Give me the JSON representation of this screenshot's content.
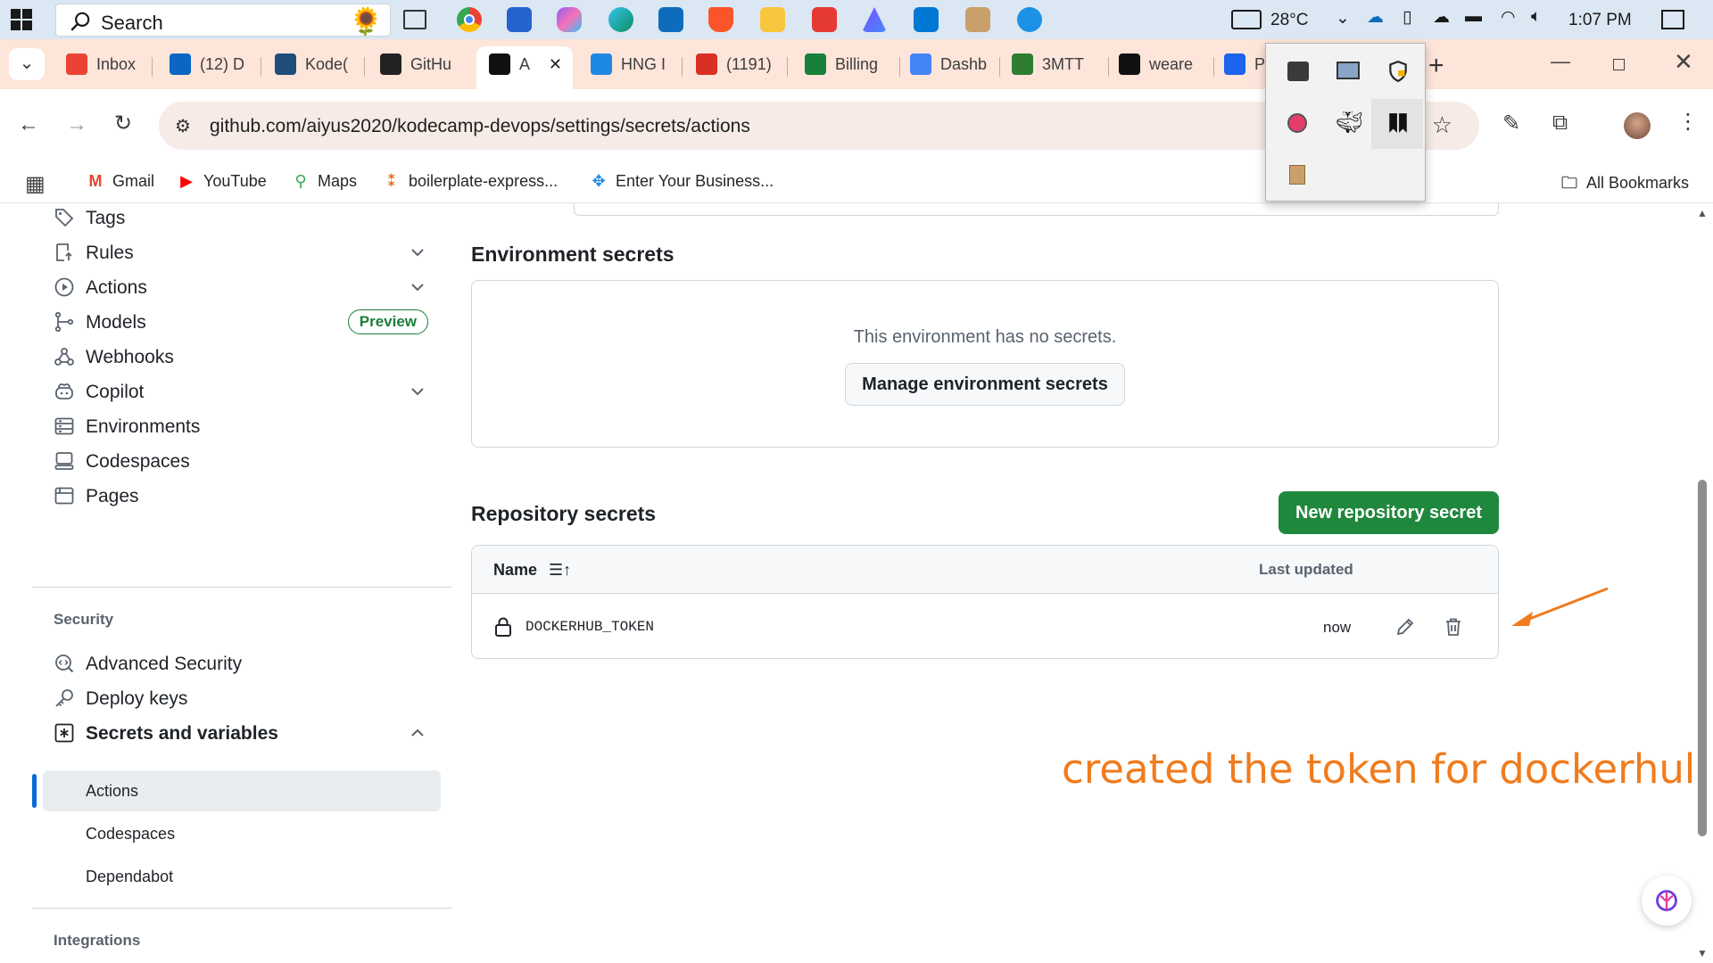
{
  "taskbar": {
    "search_label": "Search",
    "weather": "28°C",
    "time": "1:07 PM"
  },
  "tabs": [
    {
      "label": "Inbox",
      "icon": "gmail-icon",
      "color": "#ea4335"
    },
    {
      "label": "(12) D",
      "icon": "linkedin-icon",
      "color": "#0a66c2"
    },
    {
      "label": "Kode(",
      "icon": "kodecamp-icon",
      "color": "#1e4e79"
    },
    {
      "label": "GitHu",
      "icon": "openai-icon",
      "color": "#222222"
    },
    {
      "label": "A",
      "icon": "github-icon",
      "color": "#111111"
    },
    {
      "label": "HNG I",
      "icon": "hng-icon",
      "color": "#1e88e5"
    },
    {
      "label": "(1191)",
      "icon": "notification-icon",
      "color": "#d93025"
    },
    {
      "label": "Billing",
      "icon": "billing-icon",
      "color": "#188038"
    },
    {
      "label": "Dashb",
      "icon": "dashboard-icon",
      "color": "#4285f4"
    },
    {
      "label": "3MTT",
      "icon": "3mtt-icon",
      "color": "#2e7d32"
    },
    {
      "label": "weare",
      "icon": "github-icon",
      "color": "#111111"
    },
    {
      "label": "P",
      "icon": "docker-icon",
      "color": "#1d63ed"
    }
  ],
  "address_bar": {
    "url": "github.com/aiyus2020/kodecamp-devops/settings/secrets/actions"
  },
  "bookmarks": [
    {
      "label": "Gmail",
      "icon": "gmail-icon"
    },
    {
      "label": "YouTube",
      "icon": "youtube-icon"
    },
    {
      "label": "Maps",
      "icon": "maps-icon"
    },
    {
      "label": "boilerplate-express...",
      "icon": "replit-icon"
    },
    {
      "label": "Enter Your Business...",
      "icon": "business-icon"
    }
  ],
  "bookmarks_all": "All Bookmarks",
  "sidebar": {
    "items": [
      {
        "label": "Tags",
        "icon": "tag-icon"
      },
      {
        "label": "Rules",
        "icon": "rules-icon"
      },
      {
        "label": "Actions",
        "icon": "play-icon"
      },
      {
        "label": "Models",
        "icon": "models-icon"
      },
      {
        "label": "Webhooks",
        "icon": "webhook-icon"
      },
      {
        "label": "Copilot",
        "icon": "copilot-icon"
      },
      {
        "label": "Environments",
        "icon": "server-icon"
      },
      {
        "label": "Codespaces",
        "icon": "codespaces-icon"
      },
      {
        "label": "Pages",
        "icon": "browser-icon"
      }
    ],
    "preview_badge": "Preview",
    "security_heading": "Security",
    "security_items": [
      {
        "label": "Advanced Security",
        "icon": "codescan-icon"
      },
      {
        "label": "Deploy keys",
        "icon": "key-icon"
      },
      {
        "label": "Secrets and variables",
        "icon": "asterisk-icon"
      }
    ],
    "secrets_sub": [
      "Actions",
      "Codespaces",
      "Dependabot"
    ],
    "integrations_heading": "Integrations"
  },
  "main": {
    "env_title": "Environment secrets",
    "env_empty": "This environment has no secrets.",
    "env_button": "Manage environment secrets",
    "repo_title": "Repository secrets",
    "new_secret_button": "New repository secret",
    "col_name": "Name",
    "col_updated": "Last updated",
    "secrets": [
      {
        "name": "DOCKERHUB_TOKEN",
        "updated": "now"
      }
    ]
  },
  "annotation": "created the token for dockerhub",
  "colors": {
    "accent_green": "#1f883d",
    "selected_bar": "#0969da",
    "annotation": "#f07c1e"
  }
}
